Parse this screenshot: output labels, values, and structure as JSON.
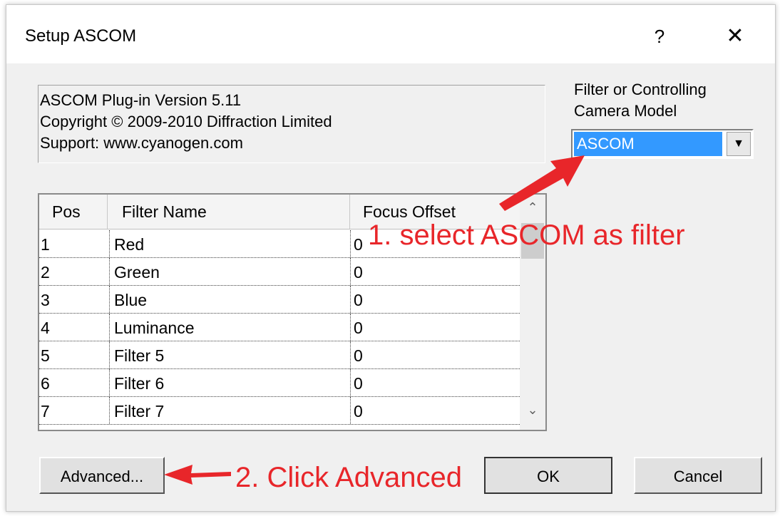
{
  "window": {
    "title": "Setup ASCOM",
    "help_label": "?",
    "close_label": "✕"
  },
  "info": {
    "line1": "ASCOM Plug-in Version 5.11",
    "line2": "Copyright © 2009-2010 Diffraction Limited",
    "line3": "Support: www.cyanogen.com"
  },
  "model": {
    "label_line1": "Filter or Controlling",
    "label_line2": "Camera Model",
    "selected": "ASCOM",
    "arrow": "▼"
  },
  "grid": {
    "columns": [
      "Pos",
      "Filter Name",
      "Focus Offset"
    ],
    "rows": [
      {
        "pos": "1",
        "name": "Red",
        "offset": "0"
      },
      {
        "pos": "2",
        "name": "Green",
        "offset": "0"
      },
      {
        "pos": "3",
        "name": "Blue",
        "offset": "0"
      },
      {
        "pos": "4",
        "name": "Luminance",
        "offset": "0"
      },
      {
        "pos": "5",
        "name": "Filter 5",
        "offset": "0"
      },
      {
        "pos": "6",
        "name": "Filter 6",
        "offset": "0"
      },
      {
        "pos": "7",
        "name": "Filter 7",
        "offset": "0"
      }
    ],
    "scroll_up": "⌃",
    "scroll_down": "⌄"
  },
  "buttons": {
    "advanced": "Advanced...",
    "ok": "OK",
    "cancel": "Cancel"
  },
  "annotations": {
    "step1": "1. select ASCOM as filter",
    "step2": "2. Click Advanced",
    "color": "#e8262a"
  }
}
